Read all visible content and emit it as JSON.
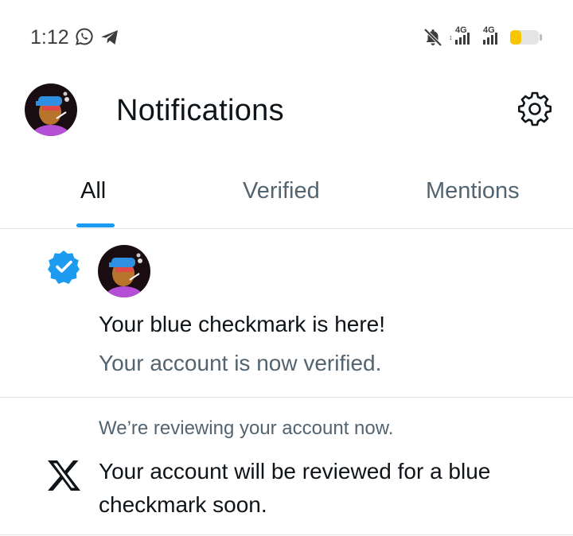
{
  "status_bar": {
    "time": "1:12",
    "network_1": "4G",
    "network_2": "4G",
    "battery_color": "#f7c600"
  },
  "header": {
    "title": "Notifications"
  },
  "tabs": [
    {
      "label": "All",
      "active": true
    },
    {
      "label": "Verified",
      "active": false
    },
    {
      "label": "Mentions",
      "active": false
    }
  ],
  "notifications": [
    {
      "icon": "verified-badge-icon",
      "title": "Your blue checkmark is here!",
      "subtitle": "Your account is now verified."
    },
    {
      "icon": "x-logo-icon",
      "subtitle": "We’re reviewing your account now.",
      "text": "Your account will be reviewed for a blue checkmark soon."
    }
  ],
  "colors": {
    "accent": "#1d9bf0",
    "text_primary": "#0f1419",
    "text_secondary": "#536471"
  }
}
